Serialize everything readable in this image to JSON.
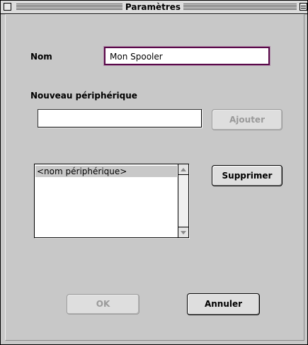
{
  "window": {
    "title": "Paramètres"
  },
  "name": {
    "label": "Nom",
    "value": "Mon Spooler"
  },
  "new_device": {
    "label": "Nouveau périphérique",
    "value": "",
    "add_label": "Ajouter"
  },
  "device_list": {
    "items": [
      "<nom périphérique>"
    ],
    "remove_label": "Supprimer"
  },
  "buttons": {
    "ok_label": "OK",
    "cancel_label": "Annuler"
  },
  "colors": {
    "window_bg": "#c8c8c8",
    "focus_ring": "#5a0a4a",
    "disabled_text": "#9a9a9a"
  },
  "icons": {
    "close": "close-box-icon",
    "zoom": "zoom-box-icon",
    "scroll_up": "arrow-up-icon",
    "scroll_down": "arrow-down-icon"
  }
}
